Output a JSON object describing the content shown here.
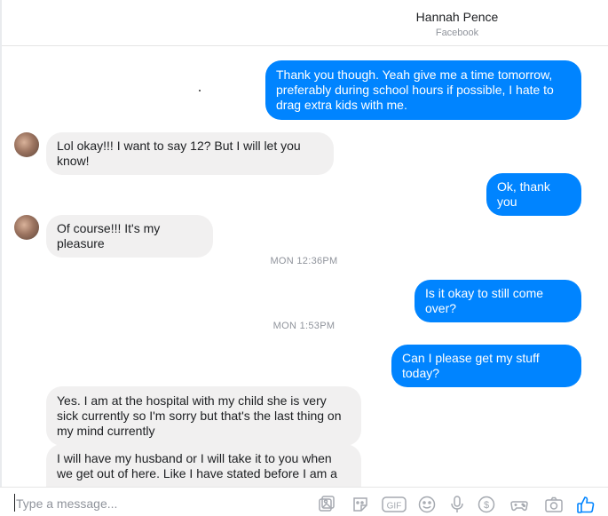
{
  "header": {
    "contact_name": "Hannah Pence",
    "subtitle": "Facebook"
  },
  "thread": {
    "messages": [
      {
        "from": "me",
        "text": "Thank you though. Yeah give me a time tomorrow, preferably during school hours if possible, I hate to drag extra kids with me."
      },
      {
        "from": "them",
        "text": "Lol okay!!! I want to say 12? But I will let you know!"
      },
      {
        "from": "me",
        "text": "Ok, thank you"
      },
      {
        "from": "them",
        "text": "Of course!!! It's my pleasure"
      },
      {
        "from": "timestamp",
        "text": "MON 12:36PM"
      },
      {
        "from": "me",
        "text": "Is it okay to still come over?"
      },
      {
        "from": "timestamp",
        "text": "MON 1:53PM"
      },
      {
        "from": "me",
        "text": "Can I please get my stuff today?"
      },
      {
        "from": "them",
        "text": "Yes. I am at the hospital with my child she is very sick currently so I'm sorry but that's the last thing on my mind currently"
      },
      {
        "from": "them",
        "text": "I will have my husband or I will take it to you when we get out of here. Like I have stated before I am a"
      }
    ]
  },
  "composer": {
    "placeholder": "Type a message...",
    "value": "",
    "tools": [
      "photo-icon",
      "sticker-icon",
      "gif-icon",
      "emoji-icon",
      "microphone-icon",
      "payment-icon",
      "game-icon",
      "camera-icon",
      "like-icon"
    ],
    "gif_label": "GIF",
    "payment_symbol": "$"
  },
  "colors": {
    "outgoing_bubble": "#0084ff",
    "incoming_bubble": "#f1f0f0",
    "muted_text": "#90949c"
  }
}
